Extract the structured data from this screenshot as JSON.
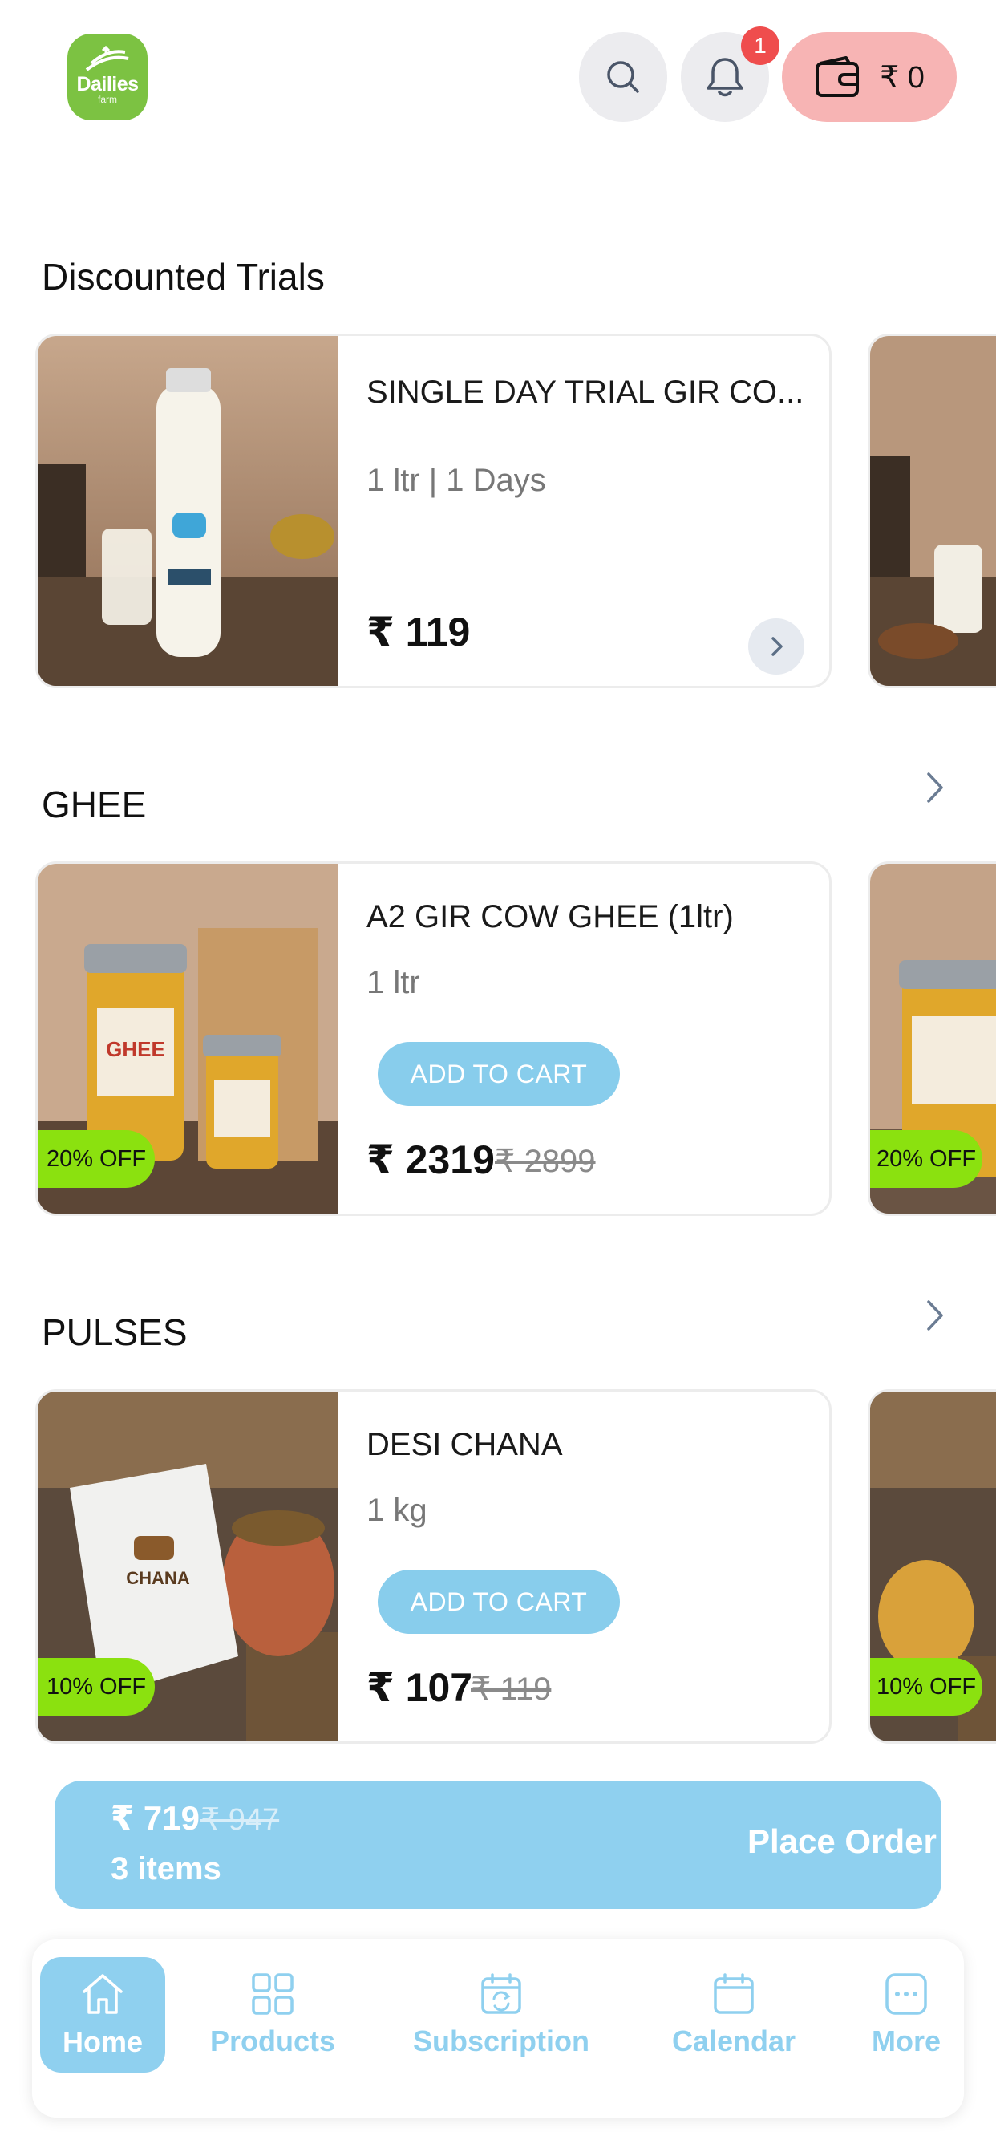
{
  "header": {
    "logo": {
      "text": "Dailies",
      "sub": "farm"
    },
    "notification_count": "1",
    "wallet": {
      "amount": "₹ 0"
    }
  },
  "sections": {
    "trials": {
      "title": "Discounted Trials",
      "product": {
        "name": "SINGLE DAY TRIAL GIR CO...",
        "qty": "1 ltr | 1 Days",
        "price": "₹ 119"
      }
    },
    "ghee": {
      "title": "GHEE",
      "product": {
        "name": "A2 GIR COW GHEE (1ltr)",
        "qty": "1 ltr",
        "price": "₹ 2319",
        "old_price": "₹ 2899",
        "discount": "20% OFF",
        "add_label": "ADD TO CART"
      },
      "peek_discount": "20% OFF"
    },
    "pulses": {
      "title": "PULSES",
      "product": {
        "name": "DESI CHANA",
        "qty": "1 kg",
        "price": "₹ 107",
        "old_price": "₹ 119",
        "discount": "10% OFF",
        "add_label": "ADD TO CART"
      },
      "peek_discount": "10% OFF"
    }
  },
  "order_bar": {
    "total": "₹ 719",
    "old_total": "₹ 947",
    "items": "3 items",
    "cta": "Place Order"
  },
  "bottom_nav": {
    "items": [
      {
        "label": "Home",
        "icon": "home-icon",
        "active": true
      },
      {
        "label": "Products",
        "icon": "grid-icon",
        "active": false
      },
      {
        "label": "Subscription",
        "icon": "calendar-refresh-icon",
        "active": false
      },
      {
        "label": "Calendar",
        "icon": "calendar-icon",
        "active": false
      },
      {
        "label": "More",
        "icon": "more-icon",
        "active": false
      }
    ]
  },
  "colors": {
    "accent": "#8fd0ef",
    "brand_green": "#7cc242",
    "discount_green": "#8be10f",
    "wallet_pink": "#f7b4b4",
    "badge_red": "#ef4d4d"
  }
}
